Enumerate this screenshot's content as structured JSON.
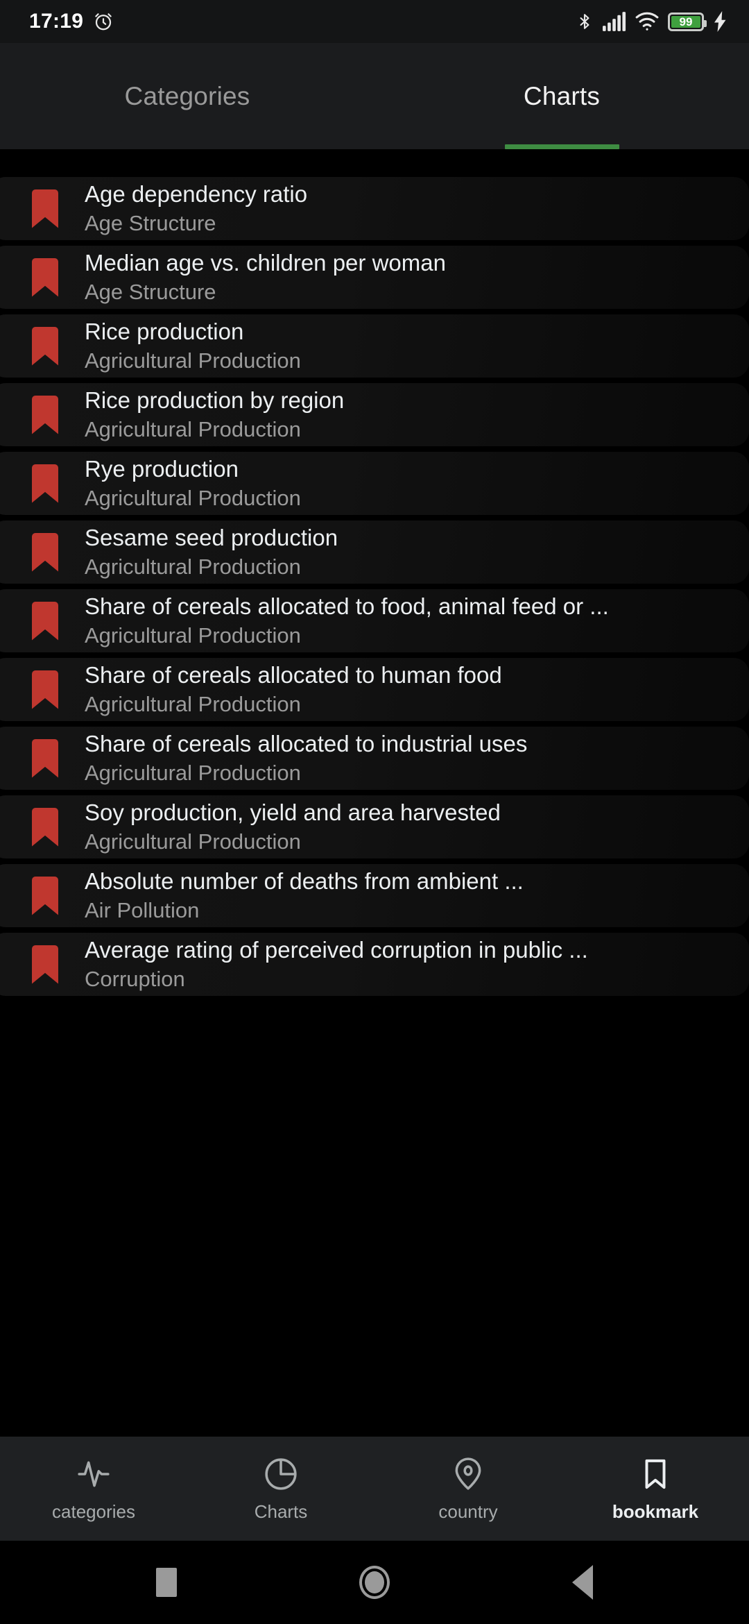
{
  "status_bar": {
    "time": "17:19",
    "alarm_icon": "alarm-icon",
    "bluetooth_icon": "bluetooth-icon",
    "signal_icon": "cellular-signal-icon",
    "wifi_icon": "wifi-icon",
    "battery_level": "99",
    "battery_percent": 99,
    "charging_icon": "charging-bolt-icon"
  },
  "top_tabs": {
    "items": [
      {
        "label": "Categories",
        "active": false
      },
      {
        "label": "Charts",
        "active": true
      }
    ],
    "indicator_color": "#3e8c42"
  },
  "list": {
    "bookmark_color": "#c0372f",
    "items": [
      {
        "title": "Age dependency ratio",
        "category": "Age Structure"
      },
      {
        "title": "Median age vs. children per woman",
        "category": "Age Structure"
      },
      {
        "title": "Rice production",
        "category": "Agricultural Production"
      },
      {
        "title": "Rice production by region",
        "category": "Agricultural Production"
      },
      {
        "title": "Rye production",
        "category": "Agricultural Production"
      },
      {
        "title": "Sesame seed production",
        "category": "Agricultural Production"
      },
      {
        "title": "Share of cereals allocated to food, animal feed or ...",
        "category": "Agricultural Production"
      },
      {
        "title": "Share of cereals allocated to human food",
        "category": "Agricultural Production"
      },
      {
        "title": "Share of cereals allocated to industrial uses",
        "category": "Agricultural Production"
      },
      {
        "title": "Soy production, yield and area harvested",
        "category": "Agricultural Production"
      },
      {
        "title": "Absolute number of deaths from ambient ...",
        "category": "Air Pollution"
      },
      {
        "title": "Average rating of perceived corruption in public ...",
        "category": "Corruption"
      }
    ]
  },
  "bottom_nav": {
    "items": [
      {
        "label": "categories",
        "icon": "activity-pulse-icon",
        "active": false
      },
      {
        "label": "Charts",
        "icon": "pie-chart-icon",
        "active": false
      },
      {
        "label": "country",
        "icon": "location-pin-icon",
        "active": false
      },
      {
        "label": "bookmark",
        "icon": "bookmark-icon",
        "active": true
      }
    ]
  },
  "android_nav": {
    "recents": "square-recents-icon",
    "home": "circle-home-icon",
    "back": "triangle-back-icon"
  }
}
